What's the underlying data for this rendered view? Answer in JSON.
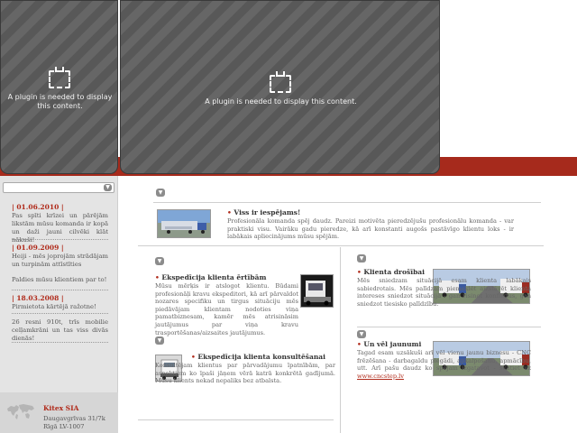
{
  "plugins": {
    "left_message": "A plugin is needed to display this content.",
    "right_message": "A plugin is needed to display this content."
  },
  "colors": {
    "accent_red": "#a62a1c",
    "date_red": "#b02a1a",
    "sidebar_bg": "#e4e4e4"
  },
  "sidebar": {
    "select_value": "",
    "news": [
      {
        "date": "| 01.06.2010 |",
        "text": "Pas spīti krīzei un pārējām likstām mūsu komanda ir kopā un daži jauni cilvēki klāt nākuši!"
      },
      {
        "date": "| 01.09.2009 |",
        "text": "Heiji - mēs joprojām strādājam un turpinām attīstīties"
      },
      {
        "date": "",
        "text": "Paldies mūsu klientiem par to!"
      },
      {
        "date": "| 18.03.2008 |",
        "text": "Pirmietota kārtējā ražotne!"
      },
      {
        "date": "",
        "text": "26 resni 910t, trīs mobilie celļamkrāni un tas viss divās dienās!"
      }
    ],
    "company": {
      "name": "Kitex SIA",
      "address_line1": "Daugavgrīvas 31/7k",
      "address_line2": "Rīgā LV-1007"
    }
  },
  "main": {
    "feature": {
      "title": "Viss ir iespējams!",
      "body": "Profesionāla komanda spēj daudz. Pareizi motivēta pieredzējušu profesionālu komanda - var praktiski visu. Vairāku gadu pieredze, kā arī konstanti augošs pastāvīgo klientu loks - ir labākais apliecinājums mūsu spējām."
    },
    "articles_left": [
      {
        "title": "Ekspedīcija klienta ērtībām",
        "body": "Mūsu mērķis ir atslogot klientu. Būdami profesionāļi kravu ekspeditori, kā arī pārvaldot nozares specifiku un tirgus situāciju mēs piedāvājam klientam nodoties viņa pamatbiznesam, kamēr mēs atrisināsim jautājumus par viņa kravu trasportēšanas/aizsaites jautājumus."
      },
      {
        "title": "Ekspedīcija klienta konsultēšanai",
        "body": "Konsultējam klientus par pārvadājumu īpatnībām, par aspektiem ko īpaši jāņem vērā katrā konkrētā gadījumā. Mūsu klients nekad nepaliks bez atbalsta."
      }
    ],
    "articles_right": [
      {
        "title": "Klienta drošībai",
        "body": "Mēs sniedzam situācijā esam klienta labākais sabiedrotais. Mēs palīdzam piemeklēt aizstāvēt klienta intereses sniedzot situācijā - gan risinot konfliktus, gan sniedzot tiesisko palīdzību."
      },
      {
        "title": "Un vēl jaunumi",
        "body": "Tagad esam uzsākuši arī vēl vienu jaunu biznesu - CNC frēzēšana - darbagaldu piegādi, apkalpošanu, apmācību, utt. Arī pašu daudz ko spējam izgatavot - skatiet uz",
        "link": "www.cncstep.lv"
      }
    ]
  }
}
